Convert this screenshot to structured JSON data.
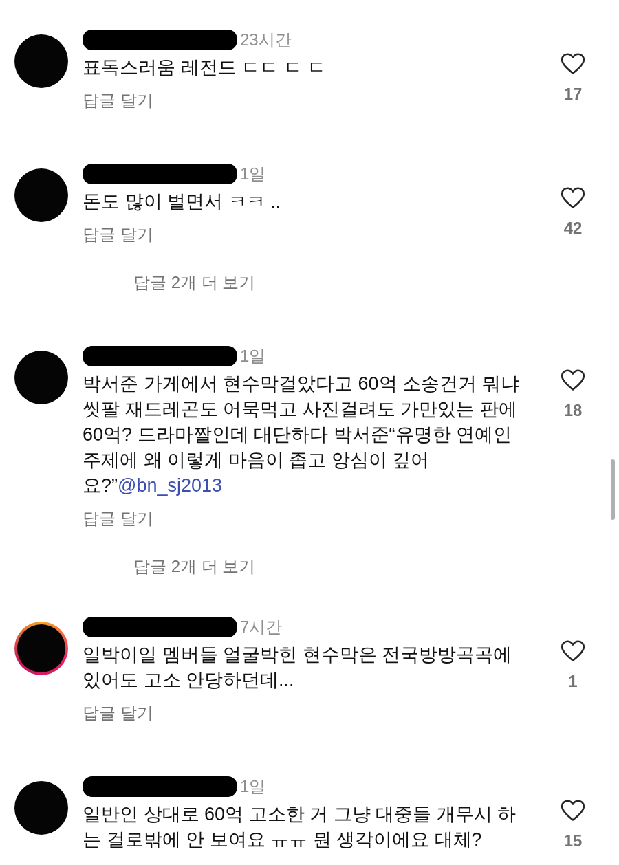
{
  "comments": [
    {
      "time": "23시간",
      "story_ring": false,
      "text": "표독스러움 레전드 ㄷㄷ ㄷ ㄷ",
      "reply_label": "답글 달기",
      "likes": "17"
    },
    {
      "time": "1일",
      "story_ring": false,
      "text": "돈도 많이 벌면서 ㅋㅋ ..",
      "reply_label": "답글 달기",
      "likes": "42",
      "more_replies": "답글 2개 더 보기"
    },
    {
      "time": "1일",
      "story_ring": false,
      "text": "박서준 가게에서 현수막걸았다고 60억 소송건거 뭐냐 씻팔 재드레곤도 어묵먹고 사진걸려도 가만있는 판에 60억? 드라마짤인데 대단하다 박서준“유명한 연예인 주제에 왜 이렇게 마음이 좁고 앙심이 깊어요?”",
      "mention": "@bn_sj2013",
      "reply_label": "답글 달기",
      "likes": "18",
      "more_replies": "답글 2개 더 보기"
    },
    {
      "time": "7시간",
      "story_ring": true,
      "text": "일박이일 멤버들 얼굴박힌 현수막은 전국방방곡곡에 있어도 고소 안당하던데...",
      "reply_label": "답글 달기",
      "likes": "1"
    },
    {
      "time": "1일",
      "story_ring": false,
      "text": "일반인 상대로 60억 고소한 거 그냥 대중들 개무시 하는 걸로밖에 안 보여요 ㅠㅠ 뭔 생각이에요 대체?",
      "likes": "15"
    }
  ]
}
